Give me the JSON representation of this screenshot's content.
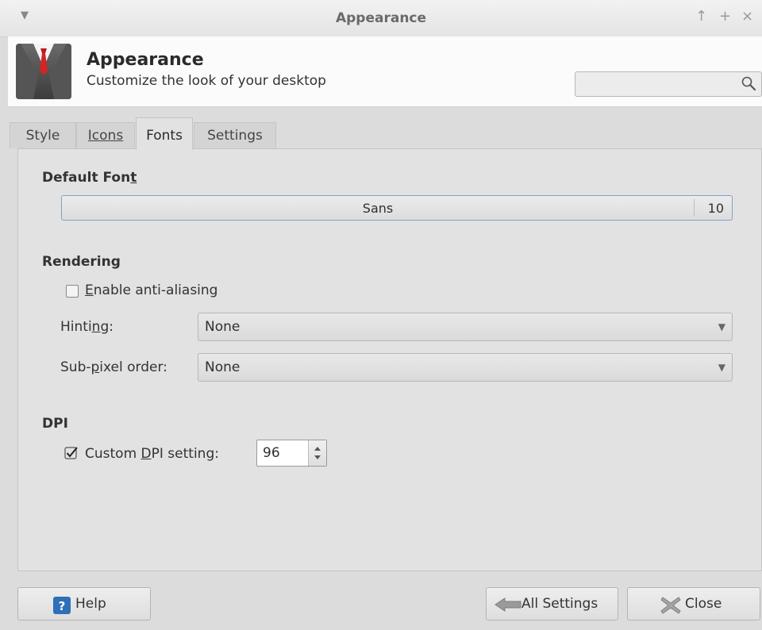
{
  "window": {
    "title": "Appearance",
    "controls": [
      "↑",
      "+",
      "×"
    ]
  },
  "header": {
    "title": "Appearance",
    "subtitle": "Customize the look of your desktop",
    "search_value": ""
  },
  "tabs": [
    {
      "label": "Style",
      "active": false
    },
    {
      "label": "Icons",
      "active": false
    },
    {
      "label": "Fonts",
      "active": true
    },
    {
      "label": "Settings",
      "active": false
    }
  ],
  "fonts": {
    "default_font": {
      "title_pre": "Default Fon",
      "title_mnemonic": "t",
      "font_name": "Sans",
      "font_size": "10"
    },
    "rendering": {
      "title": "Rendering",
      "antialias_mnemonic": "E",
      "antialias_rest": "nable anti-aliasing",
      "antialias_checked": false,
      "hinting_pre": "Hinti",
      "hinting_mnemonic": "n",
      "hinting_post": "g:",
      "hinting_value": "None",
      "subpixel_pre": "Sub-",
      "subpixel_mnemonic": "p",
      "subpixel_post": "ixel order:",
      "subpixel_value": "None"
    },
    "dpi": {
      "title": "DPI",
      "custom_pre": "Custom ",
      "custom_mnemonic": "D",
      "custom_post": "PI setting:",
      "custom_checked": true,
      "value": "96"
    }
  },
  "buttons": {
    "help": "Help",
    "all_settings": "All Settings",
    "close": "Close"
  }
}
